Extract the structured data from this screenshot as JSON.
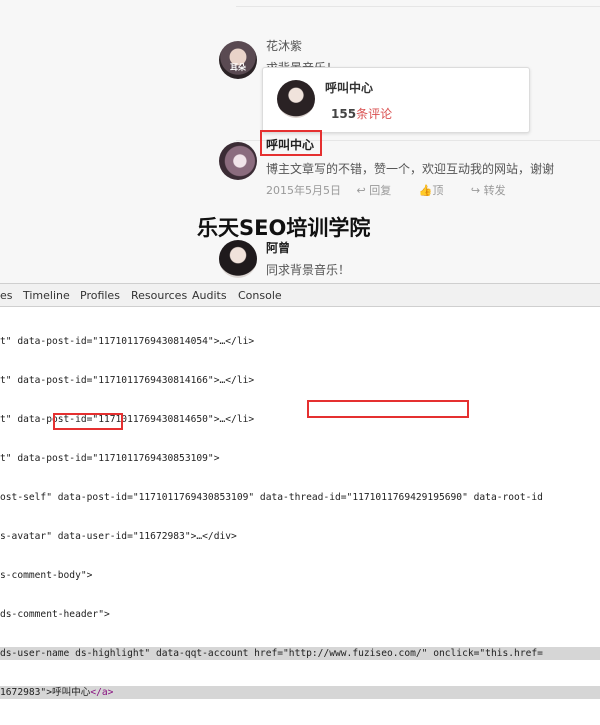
{
  "comments": [
    {
      "author": "花沐紫",
      "text": "求背景音乐！",
      "avatar_label": "耳朵"
    },
    {
      "author": "呼叫中心",
      "text": "博主文章写的不错，赞一个，欢迎互动我的网站，谢谢",
      "date": "2015年5月5日",
      "reply": "回复",
      "top": "顶",
      "share": "转发"
    },
    {
      "author": "阿曾",
      "text": "同求背景音乐！"
    }
  ],
  "popup": {
    "name": "呼叫中心",
    "count": "155",
    "count_unit": "条评论"
  },
  "watermark": "乐天SEO培训学院",
  "devtools": {
    "tabs": [
      "es",
      "Timeline",
      "Profiles",
      "Resources",
      "Audits",
      "Console"
    ],
    "lines": [
      "t\" data-post-id=\"1171011769430814054\">…</li>",
      "t\" data-post-id=\"1171011769430814166\">…</li>",
      "t\" data-post-id=\"1171011769430814650\">…</li>",
      "t\" data-post-id=\"1171011769430853109\">",
      "ost-self\" data-post-id=\"1171011769430853109\" data-thread-id=\"1171011769429195690\" data-root-id",
      "s-avatar\" data-user-id=\"11672983\">…</div>",
      "s-comment-body\">",
      "ds-comment-header\">",
      "ds-user-name ds-highlight\" data-qqt-account href=\"http://www.fuziseo.com/\" onclick=\"this.href=",
      "1672983\">"
    ],
    "selected_link_text": "呼叫中心",
    "selected_close": "</a>"
  }
}
